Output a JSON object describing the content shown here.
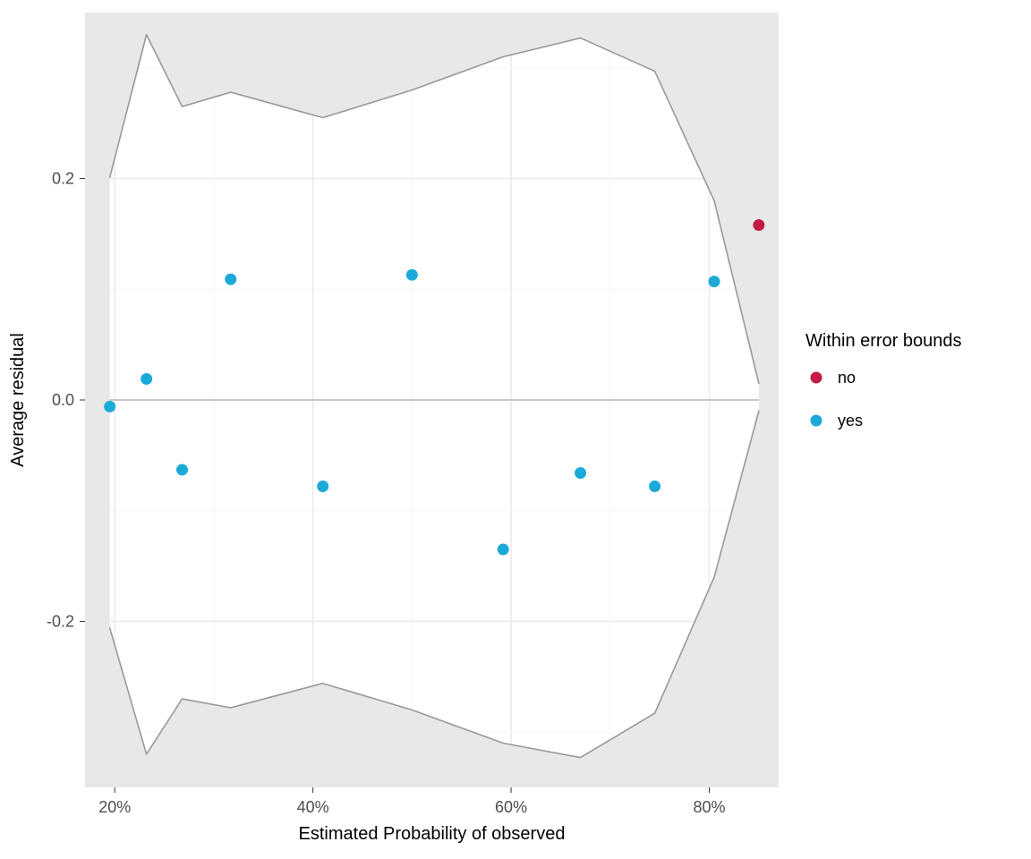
{
  "chart_data": {
    "type": "scatter",
    "xlabel": "Estimated Probability of observed",
    "ylabel": "Average residual",
    "xlim": [
      0.17,
      0.87
    ],
    "ylim": [
      -0.35,
      0.35
    ],
    "x_ticks": [
      0.2,
      0.4,
      0.6,
      0.8
    ],
    "x_tick_labels": [
      "20%",
      "40%",
      "60%",
      "80%"
    ],
    "y_ticks": [
      -0.2,
      0.0,
      0.2
    ],
    "y_tick_labels": [
      "-0.2",
      "0.0",
      "0.2"
    ],
    "legend": {
      "title": "Within error bounds",
      "items": [
        {
          "label": "no",
          "color": "#C31B46"
        },
        {
          "label": "yes",
          "color": "#1BAAD8"
        }
      ]
    },
    "series": [
      {
        "name": "yes",
        "color": "#1BAAD8",
        "points": [
          {
            "x": 0.195,
            "y": -0.006
          },
          {
            "x": 0.232,
            "y": 0.019
          },
          {
            "x": 0.268,
            "y": -0.063
          },
          {
            "x": 0.317,
            "y": 0.109
          },
          {
            "x": 0.41,
            "y": -0.078
          },
          {
            "x": 0.5,
            "y": 0.113
          },
          {
            "x": 0.592,
            "y": -0.135
          },
          {
            "x": 0.67,
            "y": -0.066
          },
          {
            "x": 0.745,
            "y": -0.078
          },
          {
            "x": 0.805,
            "y": 0.107
          }
        ]
      },
      {
        "name": "no",
        "color": "#C31B46",
        "points": [
          {
            "x": 0.85,
            "y": 0.158
          }
        ]
      }
    ],
    "error_bounds": {
      "upper": [
        {
          "x": 0.195,
          "y": 0.201
        },
        {
          "x": 0.232,
          "y": 0.33
        },
        {
          "x": 0.268,
          "y": 0.265
        },
        {
          "x": 0.317,
          "y": 0.278
        },
        {
          "x": 0.41,
          "y": 0.255
        },
        {
          "x": 0.5,
          "y": 0.28
        },
        {
          "x": 0.592,
          "y": 0.31
        },
        {
          "x": 0.67,
          "y": 0.327
        },
        {
          "x": 0.745,
          "y": 0.297
        },
        {
          "x": 0.805,
          "y": 0.18
        },
        {
          "x": 0.85,
          "y": 0.015
        }
      ],
      "lower": [
        {
          "x": 0.195,
          "y": -0.206
        },
        {
          "x": 0.232,
          "y": -0.32
        },
        {
          "x": 0.268,
          "y": -0.27
        },
        {
          "x": 0.317,
          "y": -0.278
        },
        {
          "x": 0.41,
          "y": -0.256
        },
        {
          "x": 0.5,
          "y": -0.28
        },
        {
          "x": 0.592,
          "y": -0.31
        },
        {
          "x": 0.67,
          "y": -0.323
        },
        {
          "x": 0.745,
          "y": -0.283
        },
        {
          "x": 0.805,
          "y": -0.16
        },
        {
          "x": 0.85,
          "y": -0.01
        }
      ],
      "shade_color": "#e8e8e8",
      "line_color": "#999999"
    },
    "panel": {
      "bg": "#ffffff",
      "grid_major": "#ebebeb",
      "grid_minor": "#f5f5f5",
      "zero_line": "#b8b8b8"
    },
    "colors": {
      "yes": "#1BAAD8",
      "no": "#C31B46"
    }
  }
}
